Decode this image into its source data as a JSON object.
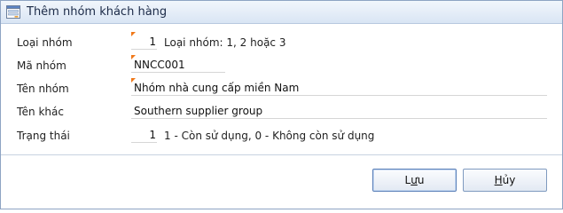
{
  "dialog": {
    "title": "Thêm nhóm khách hàng"
  },
  "form": {
    "group_type": {
      "label": "Loại nhóm",
      "value": "1",
      "hint": "Loại nhóm: 1, 2 hoặc 3"
    },
    "group_code": {
      "label": "Mã nhóm",
      "value": "NNCC001"
    },
    "group_name": {
      "label": "Tên nhóm",
      "value": "Nhóm nhà cung cấp miền Nam"
    },
    "other_name": {
      "label": "Tên khác",
      "value": "Southern supplier group"
    },
    "status": {
      "label": "Trạng thái",
      "value": "1",
      "hint": "1 - Còn sử dụng, 0 - Không còn sử dụng"
    }
  },
  "buttons": {
    "save": {
      "prefix": "L",
      "mnemonic": "ư",
      "suffix": "u"
    },
    "cancel": {
      "prefix": "",
      "mnemonic": "H",
      "suffix": "ủy"
    }
  },
  "colors": {
    "required_marker": "#f07818",
    "title_bar": "#dce7f5",
    "border": "#8ea4c3"
  },
  "icons": {
    "title": "form-window-icon"
  }
}
